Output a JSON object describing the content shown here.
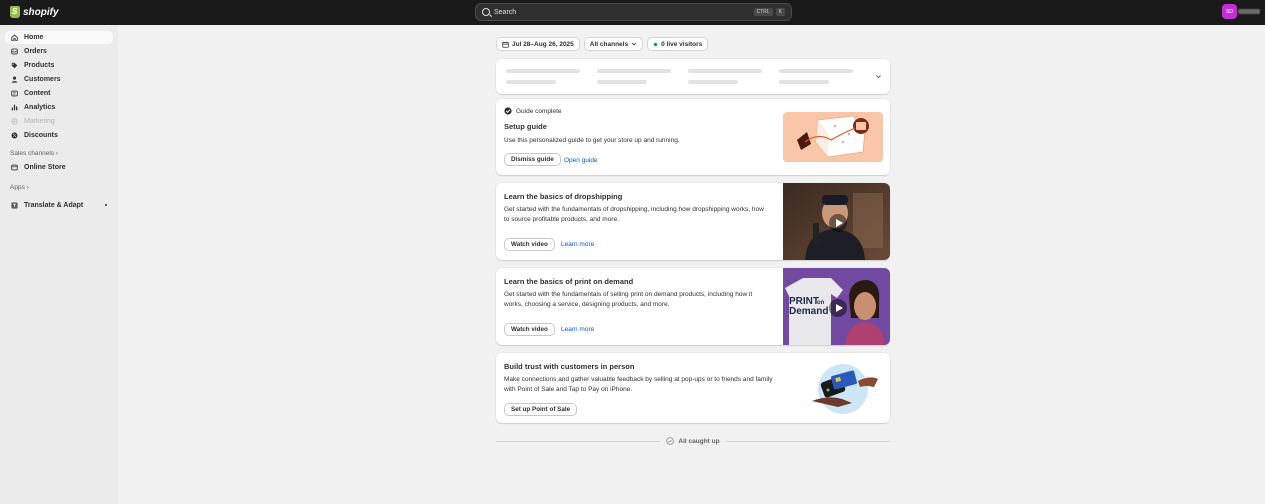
{
  "topbar": {
    "brand": "shopify",
    "search_placeholder": "Search",
    "shortcut_ctrl": "CTRL",
    "shortcut_key": "K",
    "avatar_initials": "SD"
  },
  "sidebar": {
    "items": [
      {
        "label": "Home",
        "icon": "home-icon"
      },
      {
        "label": "Orders",
        "icon": "orders-icon"
      },
      {
        "label": "Products",
        "icon": "tag-icon"
      },
      {
        "label": "Customers",
        "icon": "person-icon"
      },
      {
        "label": "Content",
        "icon": "content-icon"
      },
      {
        "label": "Analytics",
        "icon": "bar-chart-icon"
      },
      {
        "label": "Marketing",
        "icon": "target-icon"
      },
      {
        "label": "Discounts",
        "icon": "discount-icon"
      }
    ],
    "sales_channels_label": "Sales channels",
    "online_store_label": "Online Store",
    "apps_label": "Apps",
    "app_item_label": "Translate & Adapt"
  },
  "filters": {
    "date_range": "Jul 28–Aug 26, 2025",
    "channels": "All channels",
    "live_visitors": "0 live visitors"
  },
  "setup_guide": {
    "status": "Guide complete",
    "title": "Setup guide",
    "description": "Use this personalized guide to get your store up and running.",
    "dismiss_label": "Dismiss guide",
    "open_label": "Open guide"
  },
  "dropshipping": {
    "title": "Learn the basics of dropshipping",
    "description": "Get started with the fundamentals of dropshipping, including how dropshipping works, how to source profitable products, and more.",
    "watch_label": "Watch video",
    "learn_label": "Learn more"
  },
  "print_on_demand": {
    "title": "Learn the basics of print on demand",
    "description": "Get started with the fundamentals of selling print on demand products, including how it works, choosing a service, designing products, and more.",
    "watch_label": "Watch video",
    "learn_label": "Learn more",
    "shirt_text_1": "PRINT",
    "shirt_text_2": "on",
    "shirt_text_3": "Demand"
  },
  "pos": {
    "title": "Build trust with customers in person",
    "description": "Make connections and gather valuable feedback by selling at pop-ups or to friends and family with Point of Sale and Tap to Pay on iPhone.",
    "button_label": "Set up Point of Sale"
  },
  "footer": {
    "caught_up": "All caught up"
  },
  "colors": {
    "topbar": "#1a1a1a",
    "link": "#005bd3",
    "avatar": "#c22fd6",
    "setup_bg": "#f9c6a8"
  }
}
